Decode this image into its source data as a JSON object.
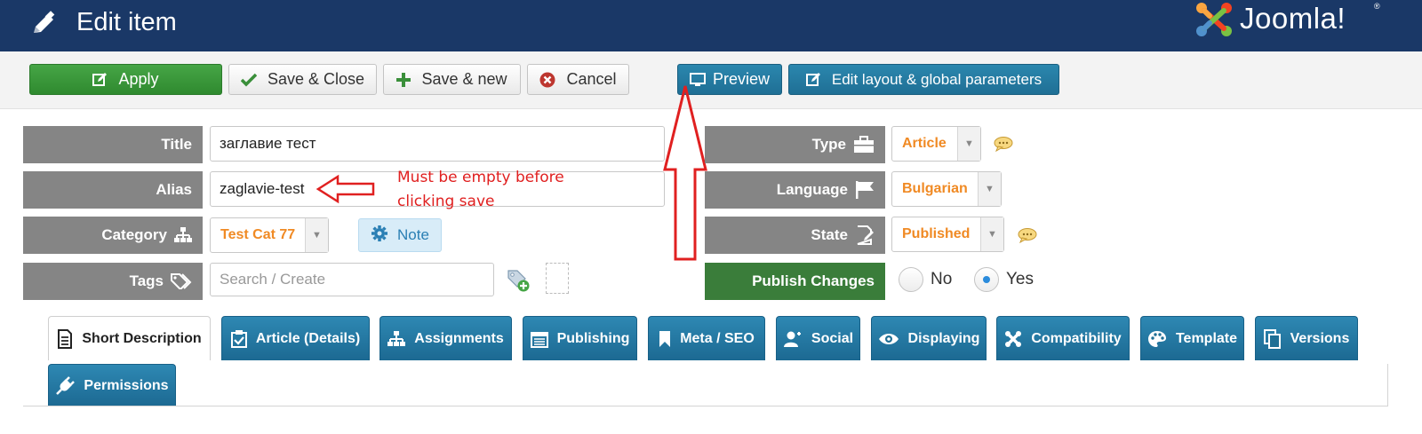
{
  "header": {
    "title": "Edit item",
    "logo_text": "Joomla!",
    "logo_reg": "®"
  },
  "toolbar": {
    "apply": "Apply",
    "save_close": "Save & Close",
    "save_new": "Save & new",
    "cancel": "Cancel",
    "preview": "Preview",
    "edit_layout": "Edit layout & global parameters"
  },
  "form": {
    "title_label": "Title",
    "title_value": "заглавие тест",
    "alias_label": "Alias",
    "alias_value": "zaglavie-test",
    "category_label": "Category",
    "category_value": "Test Cat 77",
    "note_label": "Note",
    "tags_label": "Tags",
    "tags_placeholder": "Search / Create",
    "type_label": "Type",
    "type_value": "Article",
    "language_label": "Language",
    "language_value": "Bulgarian",
    "state_label": "State",
    "state_value": "Published",
    "publish_changes_label": "Publish Changes",
    "publish_no": "No",
    "publish_yes": "Yes",
    "publish_selected": "Yes"
  },
  "annotation": {
    "line1": "Must be empty before",
    "line2": "clicking save"
  },
  "tabs": [
    {
      "label": "Short Description",
      "icon": "document-icon",
      "active": true
    },
    {
      "label": "Article (Details)",
      "icon": "checklist-icon",
      "active": false
    },
    {
      "label": "Assignments",
      "icon": "sitemap-icon",
      "active": false
    },
    {
      "label": "Publishing",
      "icon": "calendar-icon",
      "active": false
    },
    {
      "label": "Meta / SEO",
      "icon": "bookmark-icon",
      "active": false
    },
    {
      "label": "Social",
      "icon": "users-icon",
      "active": false
    },
    {
      "label": "Displaying",
      "icon": "eye-icon",
      "active": false
    },
    {
      "label": "Compatibility",
      "icon": "joomla-icon",
      "active": false
    },
    {
      "label": "Template",
      "icon": "palette-icon",
      "active": false
    },
    {
      "label": "Versions",
      "icon": "copy-icon",
      "active": false
    },
    {
      "label": "Permissions",
      "icon": "plug-icon",
      "active": false
    }
  ],
  "colors": {
    "header_bg": "#1a3867",
    "apply_green": "#3b9a3b",
    "tab_blue": "#2478a3",
    "label_gray": "#858585",
    "select_orange": "#f08a24",
    "annotation_red": "#e02020"
  }
}
